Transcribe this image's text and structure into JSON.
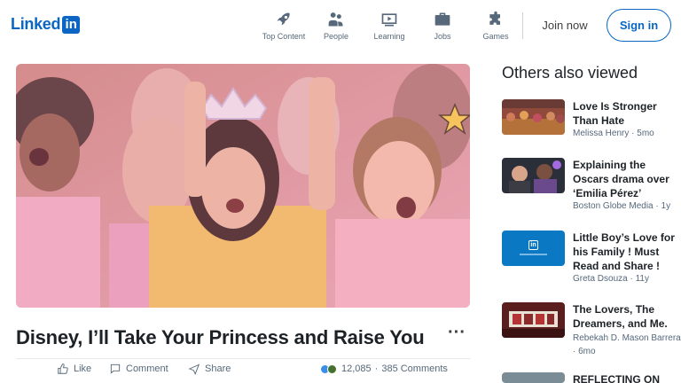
{
  "header": {
    "logo_text": "Linked",
    "logo_box": "in",
    "nav": [
      {
        "label": "Top Content",
        "icon": "rocket-icon"
      },
      {
        "label": "People",
        "icon": "people-icon"
      },
      {
        "label": "Learning",
        "icon": "learning-icon"
      },
      {
        "label": "Jobs",
        "icon": "briefcase-icon"
      },
      {
        "label": "Games",
        "icon": "puzzle-icon"
      }
    ],
    "join_label": "Join now",
    "signin_label": "Sign in"
  },
  "article": {
    "title": "Disney, I’ll Take Your Princess and Raise You",
    "more": "···",
    "actions": {
      "like": "Like",
      "comment": "Comment",
      "share": "Share"
    },
    "stats": {
      "reactions": "12,085",
      "separator": "·",
      "comments": "385 Comments"
    }
  },
  "sidebar": {
    "title": "Others also viewed",
    "items": [
      {
        "title": "Love Is Stronger Than Hate",
        "author": "Melissa Henry",
        "sep": "·",
        "time": "5mo"
      },
      {
        "title": "Explaining the Oscars drama over ‘Emilia Pérez’",
        "author": "Boston Globe Media",
        "sep": "·",
        "time": "1y"
      },
      {
        "title": "Little Boy’s Love for his Family ! Must Read and Share !",
        "author": "Greta Dsouza",
        "sep": "·",
        "time": "11y",
        "thumb_logo": "in"
      },
      {
        "title": "The Lovers, The Dreamers, and Me.",
        "author": "Rebekah D. Mason Barrera",
        "sep": "·",
        "time": "6mo"
      },
      {
        "title": "REFLECTING ON"
      }
    ]
  },
  "colors": {
    "brand": "#0a66c2",
    "text": "#1d2226",
    "muted": "#56687a"
  }
}
